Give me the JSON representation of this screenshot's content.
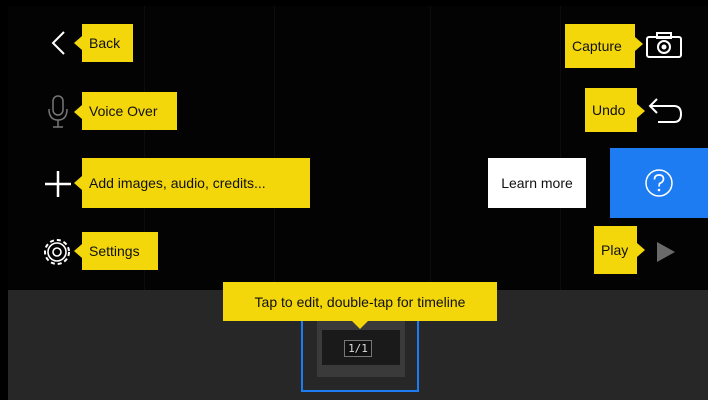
{
  "colors": {
    "tooltip": "#f3d70b",
    "accent": "#1e7cf2",
    "background": "#000000",
    "timeline": "#272727"
  },
  "toolbar_left": {
    "back": {
      "tip": "Back",
      "icon": "chevron-left-icon"
    },
    "voice_over": {
      "tip": "Voice Over",
      "icon": "microphone-icon"
    },
    "add": {
      "tip": "Add images, audio, credits...",
      "icon": "plus-icon"
    },
    "settings": {
      "tip": "Settings",
      "icon": "gear-icon"
    }
  },
  "toolbar_right": {
    "capture": {
      "tip": "Capture",
      "icon": "camera-icon"
    },
    "undo": {
      "tip": "Undo",
      "icon": "undo-arrow-icon"
    },
    "help": {
      "learn_more": "Learn more",
      "icon": "question-circle-icon"
    },
    "play": {
      "tip": "Play",
      "icon": "play-icon"
    }
  },
  "timeline": {
    "tip": "Tap to edit, double-tap for timeline",
    "clip_badge": "1/1"
  }
}
